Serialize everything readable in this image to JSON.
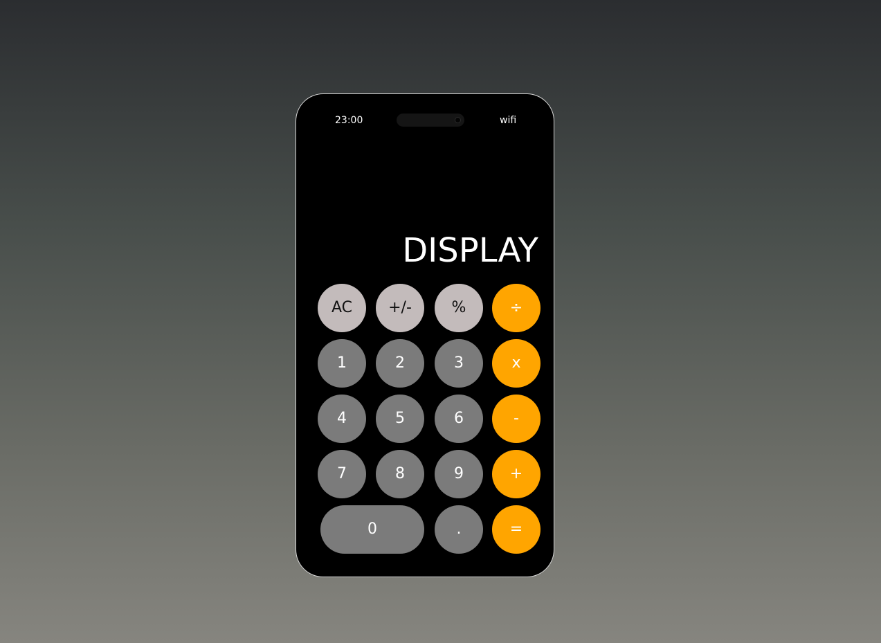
{
  "status": {
    "time": "23:00",
    "wifi": "wifi"
  },
  "display": {
    "text": "DISPLAY"
  },
  "keys": {
    "ac": "AC",
    "sign": "+/-",
    "percent": "%",
    "divide": "÷",
    "one": "1",
    "two": "2",
    "three": "3",
    "multiply": "x",
    "four": "4",
    "five": "5",
    "six": "6",
    "minus": "-",
    "seven": "7",
    "eight": "8",
    "nine": "9",
    "plus": "+",
    "zero": "0",
    "decimal": ".",
    "equals": "="
  },
  "colors": {
    "function_key": "#c3bbbb",
    "number_key": "#7b7b7b",
    "operator_key": "#ffa500",
    "screen": "#000000"
  }
}
